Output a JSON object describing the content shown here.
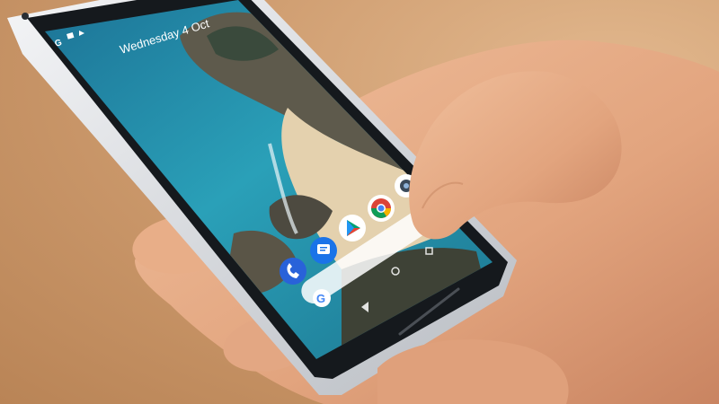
{
  "photo": {
    "background_color": "#cf9d70",
    "phone_frame_color": "#e9ebee",
    "phone_bezel_color": "#15191d",
    "skin_color": "#e8b089"
  },
  "phone": {
    "status_bar": {
      "icons": [
        "google-g-icon",
        "image-icon",
        "play-triangle-icon"
      ]
    },
    "date_widget": {
      "text": "Wednesday 4 Oct"
    },
    "wallpaper": {
      "sea_color": "#1f8fb1",
      "sand_color": "#e3d0ad",
      "rock_color": "#5b5a4e"
    },
    "apps": [
      {
        "name": "phone-app-icon",
        "color": "#2962d9"
      },
      {
        "name": "messages-app-icon",
        "color": "#1a73e8"
      },
      {
        "name": "play-store-app-icon",
        "color": "#ffffff"
      },
      {
        "name": "chrome-app-icon",
        "color": "#ffffff"
      },
      {
        "name": "camera-app-icon",
        "color": "#ffffff"
      }
    ],
    "search_bar": {
      "icon": "google-g-icon"
    },
    "nav_bar": {
      "icons": [
        "back-icon",
        "home-icon",
        "recents-icon"
      ]
    }
  }
}
